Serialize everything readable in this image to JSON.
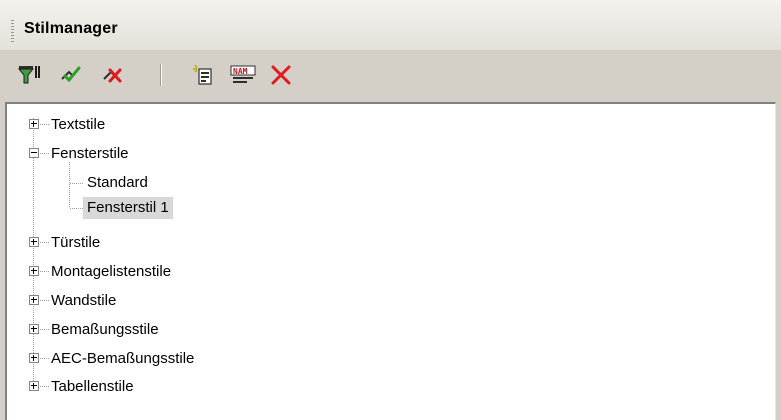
{
  "panel": {
    "title": "Stilmanager"
  },
  "toolbar": {
    "buttons": [
      {
        "name": "filter-styles",
        "icon": "filter-icon"
      },
      {
        "name": "purge-check",
        "icon": "check-icon"
      },
      {
        "name": "purge-cross",
        "icon": "purge-icon"
      },
      {
        "name": "new-style",
        "icon": "new-style-icon"
      },
      {
        "name": "edit-name",
        "icon": "rename-icon"
      },
      {
        "name": "delete",
        "icon": "delete-icon"
      }
    ]
  },
  "tree": {
    "nodes": [
      {
        "label": "Textstile",
        "state": "collapsed"
      },
      {
        "label": "Fensterstile",
        "state": "expanded",
        "children": [
          {
            "label": "Standard"
          },
          {
            "label": "Fensterstil 1",
            "selected": true
          }
        ]
      },
      {
        "label": "Türstile",
        "state": "collapsed"
      },
      {
        "label": "Montagelistenstile",
        "state": "collapsed"
      },
      {
        "label": "Wandstile",
        "state": "collapsed"
      },
      {
        "label": "Bemaßungsstile",
        "state": "collapsed"
      },
      {
        "label": "AEC-Bemaßungsstile",
        "state": "collapsed"
      },
      {
        "label": "Tabellenstile",
        "state": "collapsed"
      }
    ]
  },
  "colors": {
    "panel_bg": "#d4d0c8",
    "tree_bg": "#ffffff",
    "selection_bg": "#d8d8d8",
    "delete_red": "#e0191c",
    "check_green": "#2aa22a"
  }
}
